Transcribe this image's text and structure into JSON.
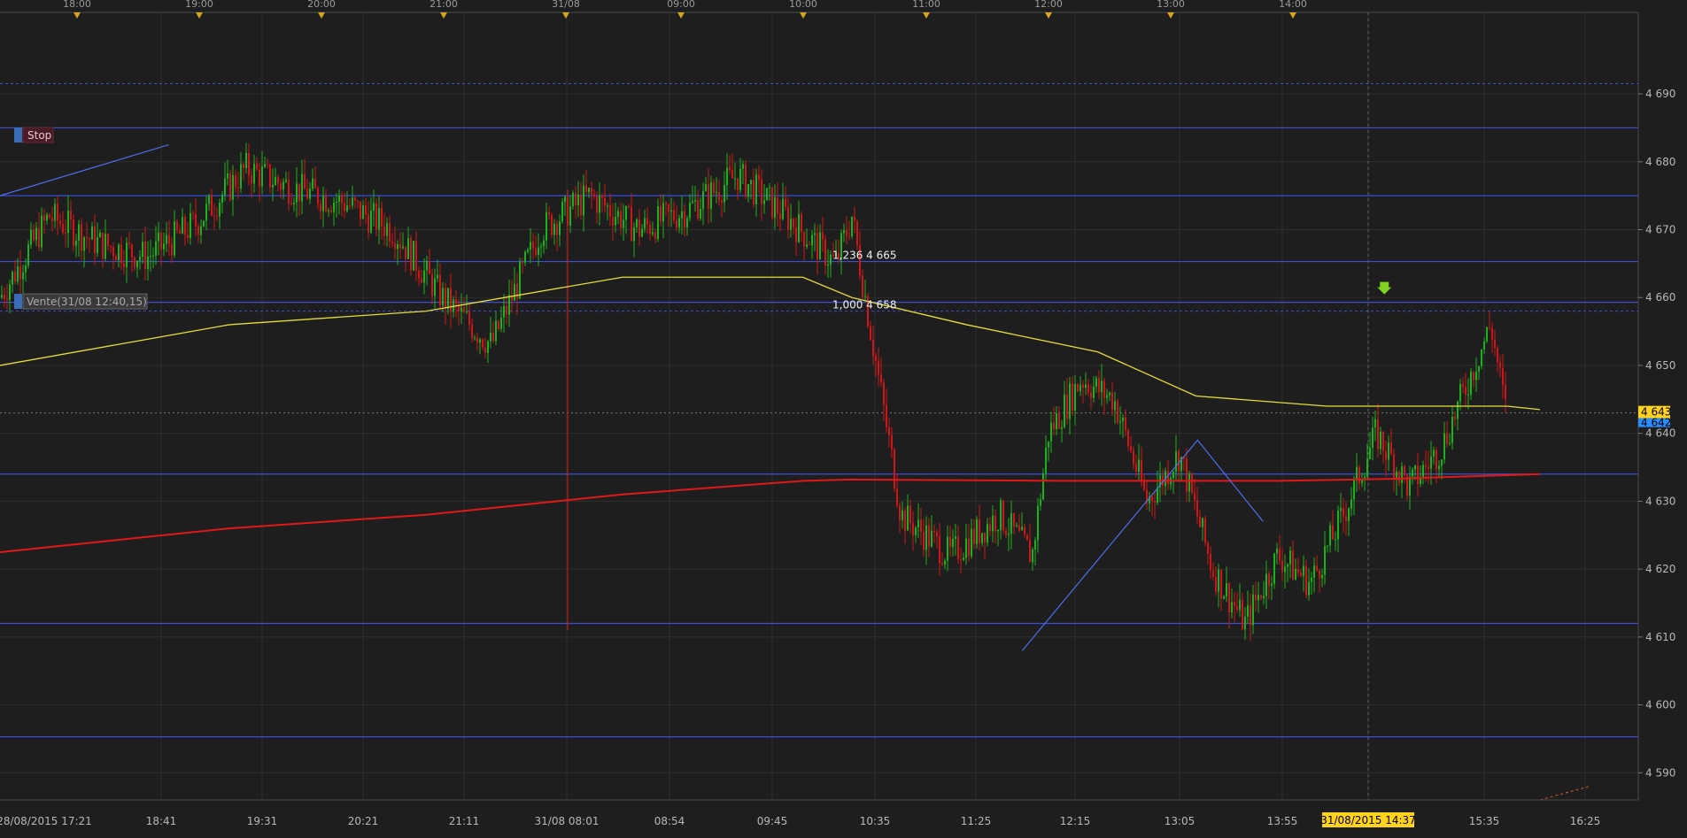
{
  "chart_data": {
    "type": "candlestick",
    "colors": {
      "background": "#1e1e1e",
      "grid": "#2f2f2f",
      "axis_text": "#b8b8b8",
      "level_line": "#3a4fd6",
      "yellow_ma": "#e8dc3a",
      "red_ma": "#e01818",
      "candle_up": "#19b419",
      "candle_down": "#d01616",
      "current_badge": "#ffd21e",
      "bid_badge": "#2b8cff"
    },
    "top_axis_labels": [
      "18:00",
      "19:00",
      "20:00",
      "21:00",
      "31/08",
      "09:00",
      "10:00",
      "11:00",
      "12:00",
      "13:00",
      "14:00"
    ],
    "bottom_axis_labels": [
      "28/08/2015 17:21",
      "18:41",
      "19:31",
      "20:21",
      "21:11",
      "31/08 08:01",
      "08:54",
      "09:45",
      "10:35",
      "11:25",
      "12:15",
      "13:05",
      "13:55",
      "31/08/2015 14:37",
      "15:35",
      "16:25"
    ],
    "y_ticks": [
      4690,
      4680,
      4670,
      4660,
      4650,
      4640,
      4630,
      4620,
      4610,
      4600,
      4590
    ],
    "y_tick_labels": [
      "4 690",
      "4 680",
      "4 670",
      "4 660",
      "4 650",
      "4 640",
      "4 630",
      "4 620",
      "4 610",
      "4 600",
      "4 590"
    ],
    "ylim": [
      4586,
      4702
    ],
    "horizontal_levels": [
      4685,
      4675,
      4665.3,
      4659.3,
      4634,
      4612,
      4595.3
    ],
    "dashed_levels": [
      4691.5,
      4658
    ],
    "fib_labels": [
      {
        "text": "1,236 4 665",
        "value": 4665.3
      },
      {
        "text": "1,000 4 658",
        "value": 4658
      }
    ],
    "current_price_label": "4 643",
    "bid_price_label": "4 642",
    "current_price": 4643,
    "order_markers": [
      {
        "text": "Stop",
        "value": 4684
      },
      {
        "text": "Vente(31/08 12:40,15)",
        "value": 4659.5
      }
    ],
    "highlighted_time_label": "31/08/2015 14:37",
    "yellow_ma_x": [
      0,
      0.14,
      0.26,
      0.38,
      0.49,
      0.52,
      0.59,
      0.67,
      0.73,
      0.81,
      0.85,
      0.92,
      0.94
    ],
    "yellow_ma_y": [
      4650,
      4656,
      4658,
      4663,
      4663,
      4660,
      4656,
      4652,
      4645.5,
      4644,
      4644,
      4644,
      4643.5
    ],
    "red_ma_x": [
      0,
      0.14,
      0.26,
      0.38,
      0.49,
      0.52,
      0.65,
      0.78,
      0.85,
      0.94
    ],
    "red_ma_y": [
      4622.5,
      4626,
      4628,
      4631,
      4633,
      4633.2,
      4633,
      4633,
      4633.3,
      4634
    ],
    "candle_anchor_x": [
      0,
      0.03,
      0.06,
      0.09,
      0.12,
      0.15,
      0.18,
      0.21,
      0.24,
      0.27,
      0.3,
      0.33,
      0.36,
      0.39,
      0.42,
      0.45,
      0.48,
      0.51,
      0.52,
      0.55,
      0.58,
      0.61,
      0.63,
      0.64,
      0.66,
      0.68,
      0.7,
      0.72,
      0.74,
      0.76,
      0.78,
      0.8,
      0.82,
      0.84,
      0.86,
      0.88,
      0.9,
      0.91,
      0.92
    ],
    "candle_anchor_y": [
      4660,
      4672,
      4668,
      4666,
      4671,
      4679,
      4676,
      4674,
      4670,
      4660,
      4653,
      4670,
      4675,
      4670,
      4673,
      4678,
      4672,
      4665,
      4672,
      4628,
      4622,
      4628,
      4622,
      4640,
      4648,
      4645,
      4630,
      4637,
      4620,
      4612,
      4622,
      4618,
      4628,
      4640,
      4632,
      4638,
      4650,
      4656,
      4642
    ],
    "trend_lines": [
      {
        "x": [
          0,
          0.103
        ],
        "y": [
          4675,
          4682.5
        ]
      },
      {
        "x": [
          0.624,
          0.731,
          0.771
        ],
        "y": [
          4608,
          4639,
          4627
        ]
      }
    ],
    "future_line": {
      "x": [
        0.94,
        0.97
      ],
      "y": [
        4586,
        4588
      ]
    },
    "sell_arrow": {
      "x": 0.845,
      "y": 4661
    }
  }
}
